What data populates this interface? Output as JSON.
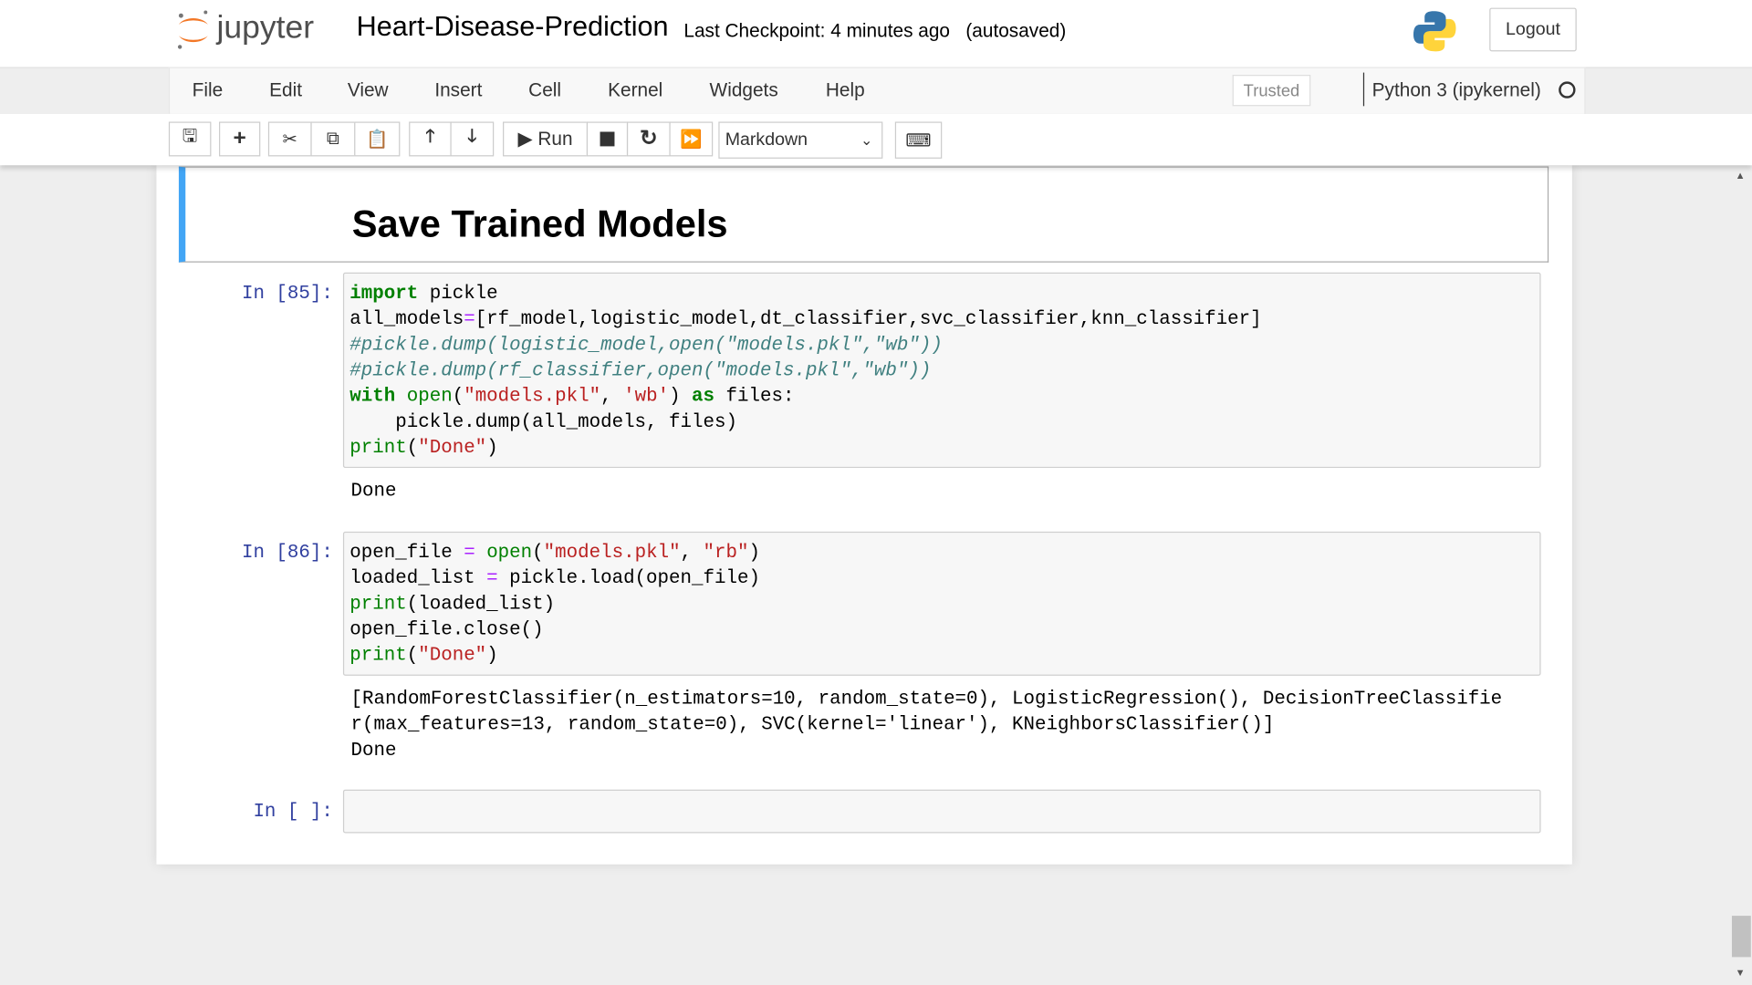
{
  "header": {
    "logo_text": "jupyter",
    "notebook_name": "Heart-Disease-Prediction",
    "checkpoint": "Last Checkpoint: 4 minutes ago",
    "autosave": "(autosaved)",
    "logout": "Logout"
  },
  "menu": {
    "items": [
      "File",
      "Edit",
      "View",
      "Insert",
      "Cell",
      "Kernel",
      "Widgets",
      "Help"
    ],
    "trusted": "Trusted",
    "kernel": "Python 3 (ipykernel)"
  },
  "toolbar": {
    "run": "Run",
    "cell_type": "Markdown",
    "icons": [
      "save-icon",
      "plus-icon",
      "cut-icon",
      "copy-icon",
      "paste-icon",
      "arrow-up-icon",
      "arrow-down-icon",
      "play-icon",
      "stop-icon",
      "restart-icon",
      "fast-forward-icon",
      "keyboard-icon"
    ]
  },
  "cells": {
    "md_heading": "Save Trained Models",
    "c85": {
      "prompt": "In [85]:",
      "output": "Done"
    },
    "c86": {
      "prompt": "In [86]:",
      "output": "[RandomForestClassifier(n_estimators=10, random_state=0), LogisticRegression(), DecisionTreeClassifie\nr(max_features=13, random_state=0), SVC(kernel='linear'), KNeighborsClassifier()]\nDone"
    },
    "empty": {
      "prompt": "In [ ]:"
    }
  },
  "colors": {
    "accent": "#42a5f5",
    "prompt": "#303f9f",
    "keyword": "#008000",
    "string": "#ba2121",
    "comment": "#408080"
  }
}
